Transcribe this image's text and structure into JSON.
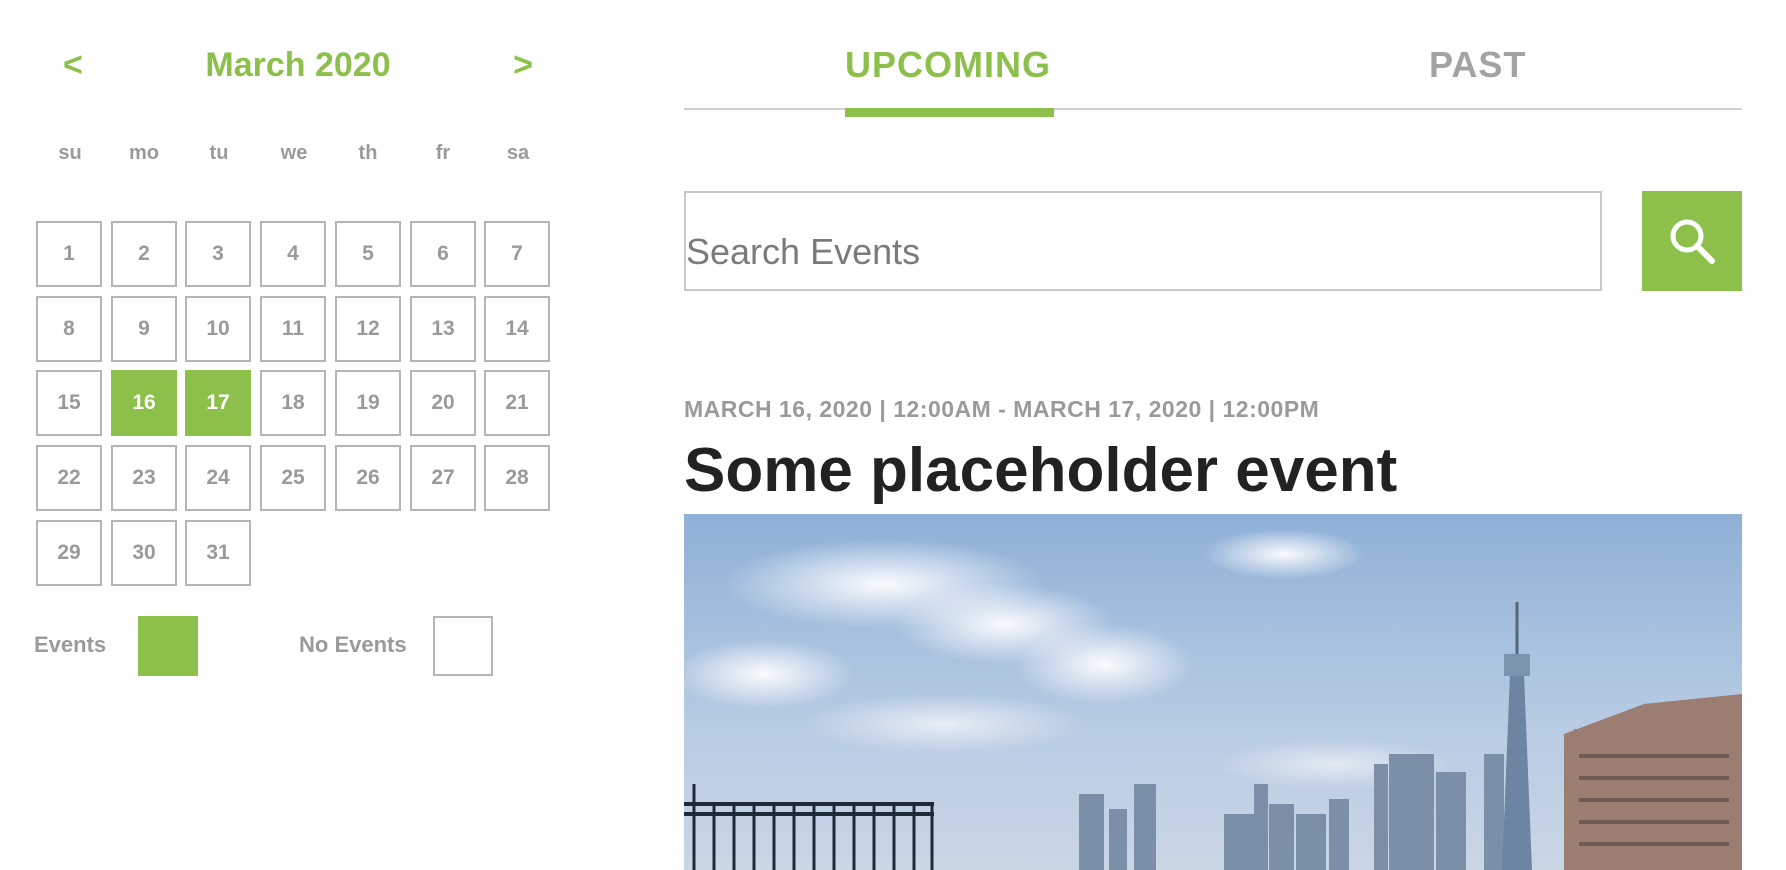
{
  "calendar": {
    "prev_label": "<",
    "next_label": ">",
    "month_title": "March 2020",
    "weekdays": [
      "su",
      "mo",
      "tu",
      "we",
      "th",
      "fr",
      "sa"
    ],
    "days": [
      {
        "num": "1",
        "event": false
      },
      {
        "num": "2",
        "event": false
      },
      {
        "num": "3",
        "event": false
      },
      {
        "num": "4",
        "event": false
      },
      {
        "num": "5",
        "event": false
      },
      {
        "num": "6",
        "event": false
      },
      {
        "num": "7",
        "event": false
      },
      {
        "num": "8",
        "event": false
      },
      {
        "num": "9",
        "event": false
      },
      {
        "num": "10",
        "event": false
      },
      {
        "num": "11",
        "event": false
      },
      {
        "num": "12",
        "event": false
      },
      {
        "num": "13",
        "event": false
      },
      {
        "num": "14",
        "event": false
      },
      {
        "num": "15",
        "event": false
      },
      {
        "num": "16",
        "event": true
      },
      {
        "num": "17",
        "event": true
      },
      {
        "num": "18",
        "event": false
      },
      {
        "num": "19",
        "event": false
      },
      {
        "num": "20",
        "event": false
      },
      {
        "num": "21",
        "event": false
      },
      {
        "num": "22",
        "event": false
      },
      {
        "num": "23",
        "event": false
      },
      {
        "num": "24",
        "event": false
      },
      {
        "num": "25",
        "event": false
      },
      {
        "num": "26",
        "event": false
      },
      {
        "num": "27",
        "event": false
      },
      {
        "num": "28",
        "event": false
      },
      {
        "num": "29",
        "event": false
      },
      {
        "num": "30",
        "event": false
      },
      {
        "num": "31",
        "event": false
      }
    ],
    "legend": {
      "events_label": "Events",
      "no_events_label": "No Events"
    }
  },
  "tabs": {
    "upcoming": "UPCOMING",
    "past": "PAST",
    "active": "upcoming"
  },
  "search": {
    "placeholder": "Search Events",
    "value": "",
    "button_icon": "search-icon"
  },
  "event": {
    "meta": "MARCH 16, 2020 | 12:00AM - MARCH 17, 2020 | 12:00PM",
    "title": "Some placeholder event",
    "image": "city-skyline-photo"
  },
  "colors": {
    "accent": "#8dc04a",
    "muted_text": "#9a9a9a",
    "title_text": "#222222",
    "border": "#b5b5b5"
  }
}
